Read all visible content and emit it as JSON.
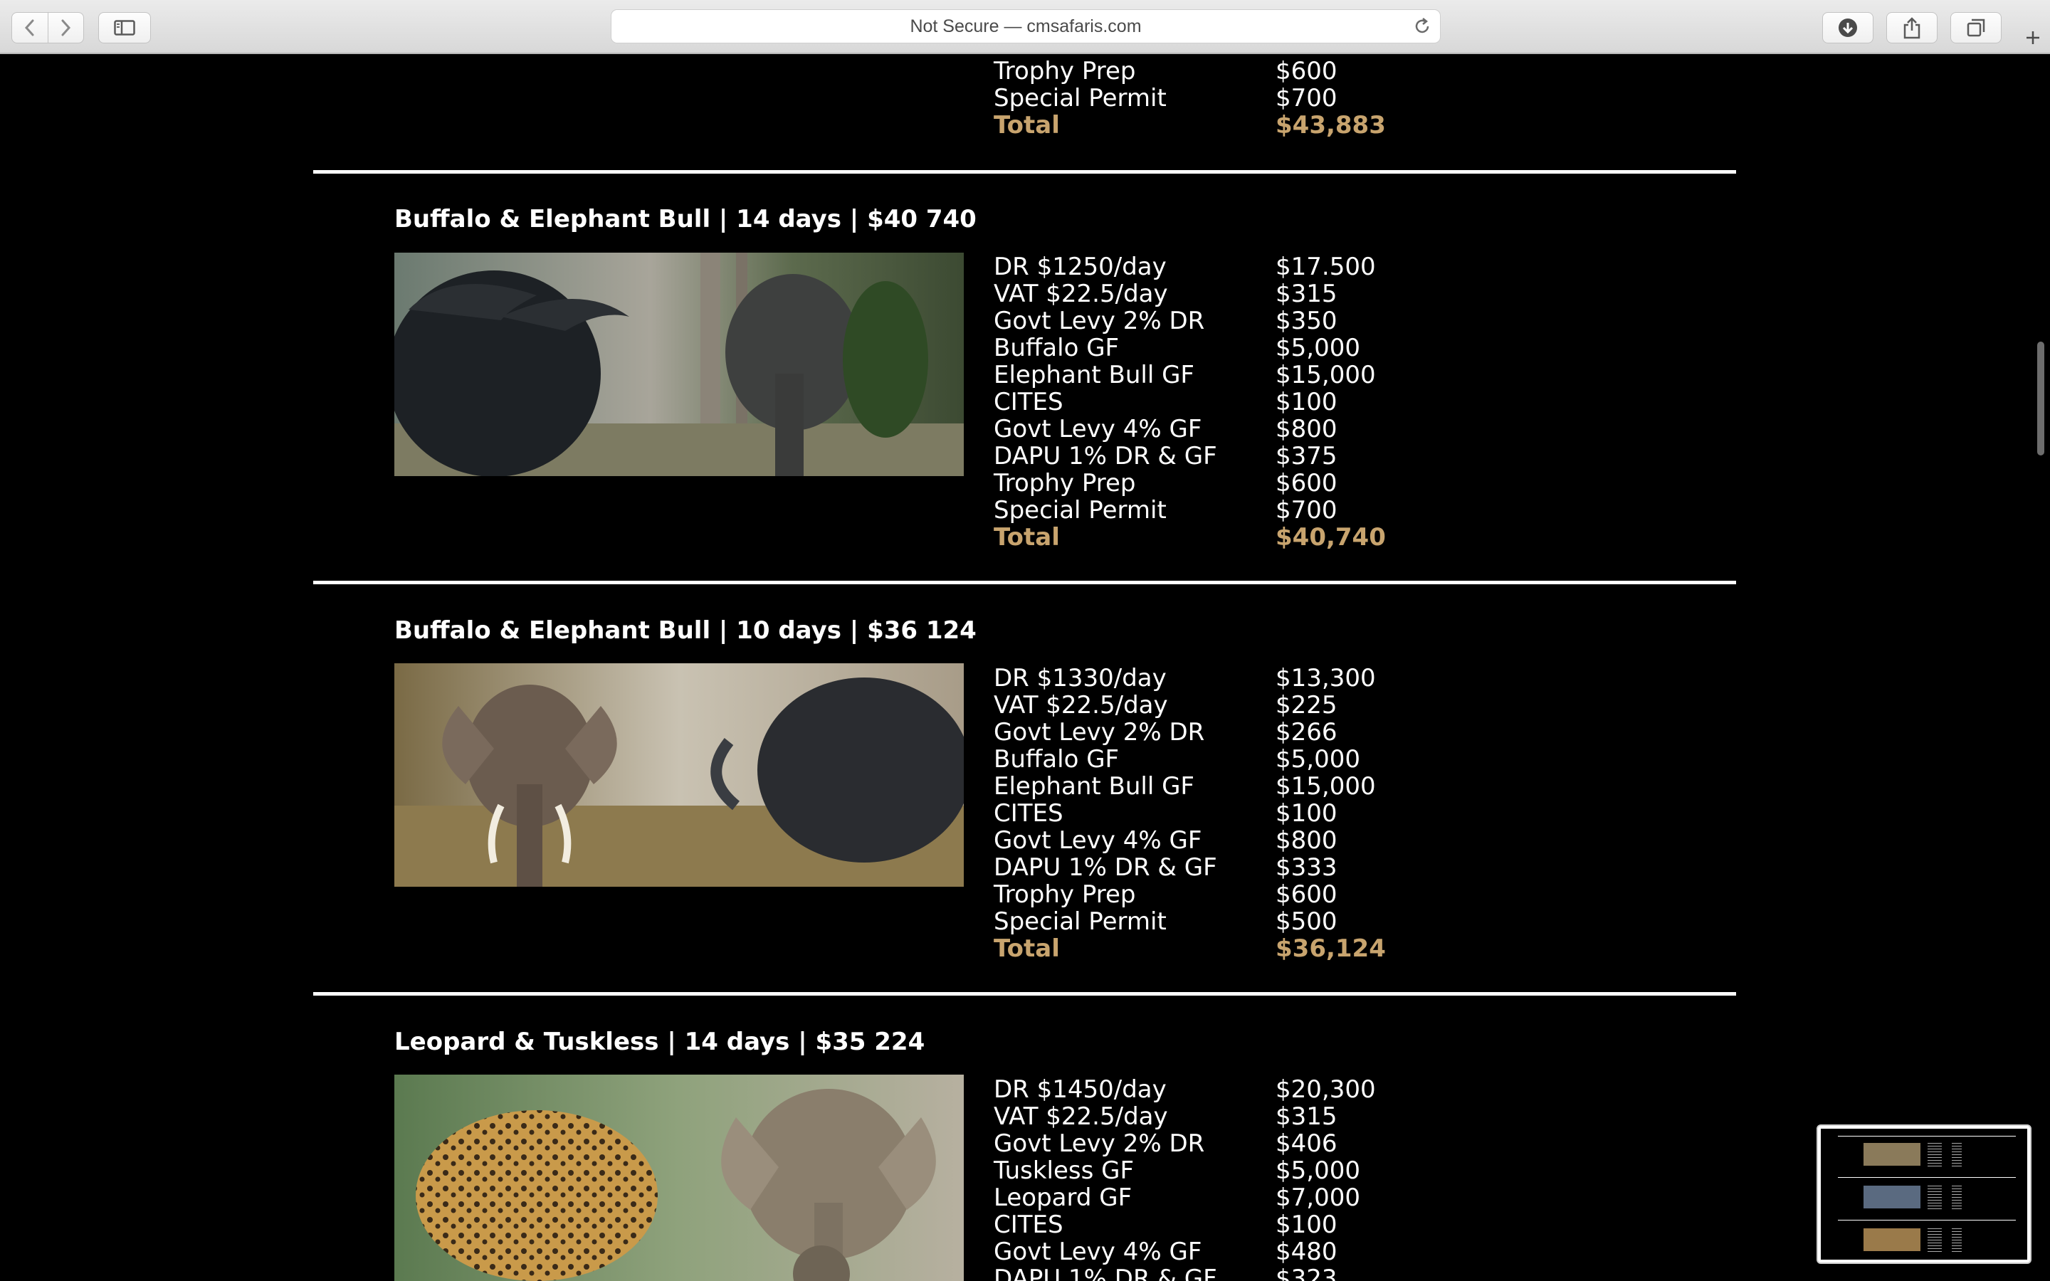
{
  "browser": {
    "address_text": "Not Secure — cmsafaris.com",
    "icons": {
      "back": "chevron-left-icon",
      "forward": "chevron-right-icon",
      "sidebar": "sidebar-icon",
      "reload": "reload-icon",
      "downloads": "download-icon",
      "share": "share-icon",
      "tabs": "tabs-icon",
      "new_tab": "plus-icon"
    }
  },
  "colors": {
    "total": "#c8a46e",
    "background": "#000000",
    "text": "#ffffff"
  },
  "top_partial": {
    "rows": [
      {
        "label": "Trophy Prep",
        "amount": "$600"
      },
      {
        "label": "Special Permit",
        "amount": "$700"
      }
    ],
    "total": {
      "label": "Total",
      "amount": "$43,883"
    }
  },
  "packages": [
    {
      "title": "Buffalo & Elephant Bull | 14 days | $40 740",
      "rows": [
        {
          "label": "DR $1250/day",
          "amount": "$17.500"
        },
        {
          "label": "VAT $22.5/day",
          "amount": "$315"
        },
        {
          "label": "Govt Levy 2% DR",
          "amount": "$350"
        },
        {
          "label": "Buffalo GF",
          "amount": "$5,000"
        },
        {
          "label": "Elephant Bull GF",
          "amount": "$15,000"
        },
        {
          "label": "CITES",
          "amount": "$100"
        },
        {
          "label": "Govt Levy 4% GF",
          "amount": "$800"
        },
        {
          "label": "DAPU 1% DR & GF",
          "amount": "$375"
        },
        {
          "label": "Trophy Prep",
          "amount": "$600"
        },
        {
          "label": "Special Permit",
          "amount": "$700"
        }
      ],
      "total": {
        "label": "Total",
        "amount": "$40,740"
      }
    },
    {
      "title": "Buffalo & Elephant Bull | 10 days | $36 124",
      "rows": [
        {
          "label": "DR $1330/day",
          "amount": "$13,300"
        },
        {
          "label": "VAT $22.5/day",
          "amount": "$225"
        },
        {
          "label": "Govt Levy 2% DR",
          "amount": "$266"
        },
        {
          "label": "Buffalo GF",
          "amount": "$5,000"
        },
        {
          "label": "Elephant Bull GF",
          "amount": "$15,000"
        },
        {
          "label": "CITES",
          "amount": "$100"
        },
        {
          "label": "Govt Levy 4% GF",
          "amount": "$800"
        },
        {
          "label": "DAPU 1% DR & GF",
          "amount": "$333"
        },
        {
          "label": "Trophy Prep",
          "amount": "$600"
        },
        {
          "label": "Special Permit",
          "amount": "$500"
        }
      ],
      "total": {
        "label": "Total",
        "amount": "$36,124"
      }
    },
    {
      "title": "Leopard & Tuskless | 14 days | $35 224",
      "rows": [
        {
          "label": "DR $1450/day",
          "amount": "$20,300"
        },
        {
          "label": "VAT $22.5/day",
          "amount": "$315"
        },
        {
          "label": "Govt Levy 2% DR",
          "amount": "$406"
        },
        {
          "label": "Tuskless GF",
          "amount": "$5,000"
        },
        {
          "label": "Leopard GF",
          "amount": "$7,000"
        },
        {
          "label": "CITES",
          "amount": "$100"
        },
        {
          "label": "Govt Levy 4% GF",
          "amount": "$480"
        },
        {
          "label": "DAPU 1% DR & GF",
          "amount": "$323"
        }
      ]
    }
  ]
}
